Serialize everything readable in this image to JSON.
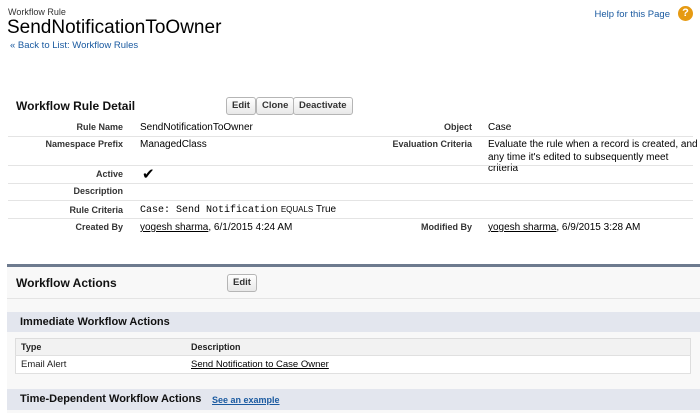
{
  "header": {
    "breadcrumb": "Workflow Rule",
    "title": "SendNotificationToOwner",
    "back_link": "« Back to List: Workflow Rules",
    "help": "Help for this Page",
    "help_icon": "?"
  },
  "detail": {
    "title": "Workflow Rule Detail",
    "buttons": [
      "Edit",
      "Clone",
      "Deactivate"
    ],
    "rule_name_label": "Rule Name",
    "rule_name": "SendNotificationToOwner",
    "object_label": "Object",
    "object": "Case",
    "namespace_label": "Namespace Prefix",
    "namespace": "ManagedClass",
    "eval_label": "Evaluation Criteria",
    "eval_1": "Evaluate the rule when a record is created, and",
    "eval_2": "any time it's edited to subsequently meet criteria",
    "active_label": "Active",
    "active": "✔",
    "description_label": "Description",
    "criteria_label": "Rule Criteria",
    "criteria_field": "Case: Send Notification",
    "criteria_op": "EQUALS",
    "criteria_value": "True",
    "created_label": "Created By",
    "created_by": "yogesh sharma",
    "created_date": ", 6/1/2015 4:24 AM",
    "modified_label": "Modified By",
    "modified_by": "yogesh sharma",
    "modified_date": ", 6/9/2015 3:28 AM"
  },
  "actions": {
    "title": "Workflow Actions",
    "edit": "Edit",
    "immediate_title": "Immediate Workflow Actions",
    "columns": [
      "Type",
      "Description"
    ],
    "rows": [
      {
        "type": "Email Alert",
        "description": "Send Notification to Case Owner"
      }
    ],
    "time_title": "Time-Dependent Workflow Actions",
    "example_link": "See an example"
  }
}
